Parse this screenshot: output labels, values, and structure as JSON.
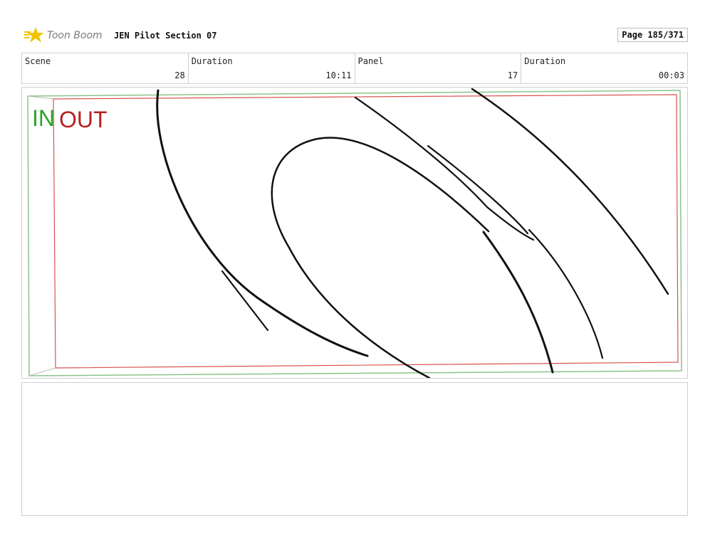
{
  "header": {
    "brand": "Toon Boom",
    "document_title": "JEN Pilot Section 07",
    "page_indicator": "Page 185/371",
    "logo_icon": "toon-boom-star-logo-icon",
    "logo_color": "#f2c400"
  },
  "info": {
    "scene_label": "Scene",
    "scene_value": "28",
    "scene_duration_label": "Duration",
    "scene_duration_value": "10:11",
    "panel_label": "Panel",
    "panel_value": "17",
    "panel_duration_label": "Duration",
    "panel_duration_value": "00:03"
  },
  "panel": {
    "in_label": "IN",
    "out_label": "OUT",
    "in_color": "#2aa52a",
    "out_color": "#b32020"
  },
  "notes": {
    "text": ""
  }
}
